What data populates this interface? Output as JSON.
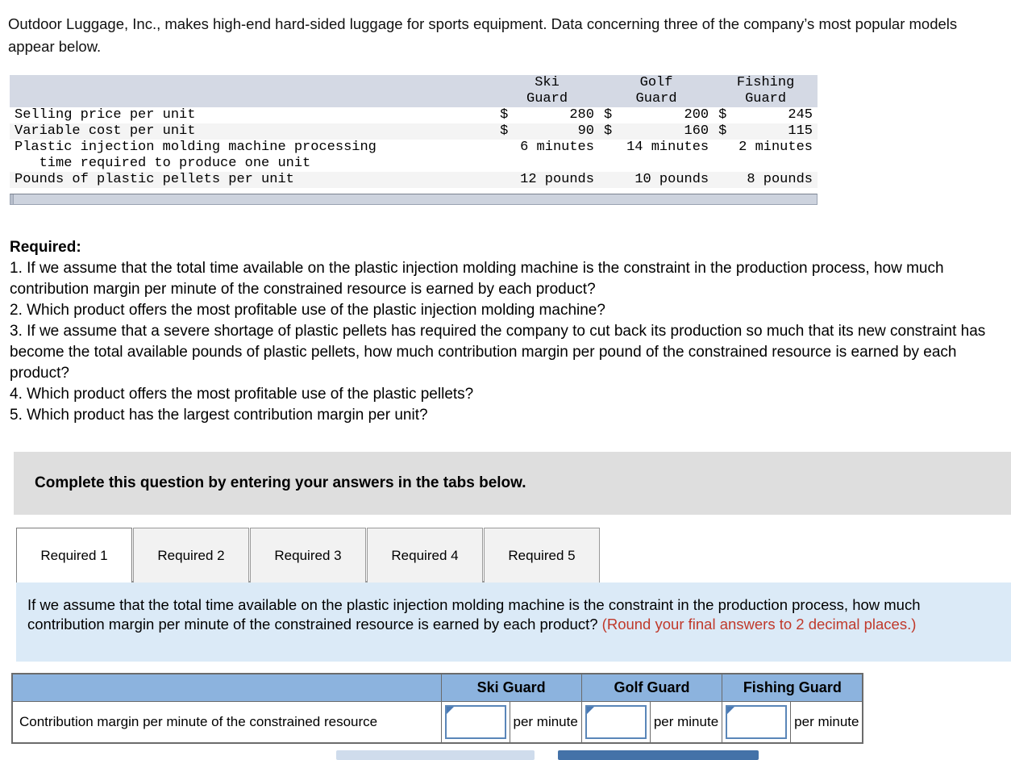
{
  "intro": "Outdoor Luggage, Inc., makes high-end hard-sided luggage for sports equipment. Data concerning three of the company’s most popular models appear below.",
  "facts_table": {
    "columns": [
      "",
      "Ski Guard",
      "Golf Guard",
      "Fishing Guard"
    ],
    "column_lines": [
      [
        "Ski",
        "Guard"
      ],
      [
        "Golf",
        "Guard"
      ],
      [
        "Fishing",
        "Guard"
      ]
    ],
    "rows": [
      {
        "label": "Selling price per unit",
        "label_line2": "",
        "currency": [
          "$",
          "$",
          "$"
        ],
        "values": [
          "280",
          "200",
          "245"
        ],
        "units": [
          "",
          "",
          ""
        ]
      },
      {
        "label": "Variable cost per unit",
        "label_line2": "",
        "currency": [
          "$",
          "$",
          "$"
        ],
        "values": [
          "90",
          "160",
          "115"
        ],
        "units": [
          "",
          "",
          ""
        ]
      },
      {
        "label": "Plastic injection molding machine processing",
        "label_line2": "   time required to produce one unit",
        "currency": [
          "",
          "",
          ""
        ],
        "values": [
          "6",
          "14",
          "2"
        ],
        "units": [
          "6 minutes",
          "14 minutes",
          "2 minutes"
        ]
      },
      {
        "label": "Pounds of plastic pellets per unit",
        "label_line2": "",
        "currency": [
          "",
          "",
          ""
        ],
        "values": [
          "12",
          "10",
          "8"
        ],
        "units": [
          "12 pounds",
          "10 pounds",
          "8 pounds"
        ]
      }
    ]
  },
  "required": {
    "heading": "Required:",
    "items": [
      "1. If we assume that the total time available on the plastic injection molding machine is the constraint in the production process, how much contribution margin per minute of the constrained resource is earned by each product?",
      "2. Which product offers the most profitable use of the plastic injection molding machine?",
      "3. If we assume that a severe shortage of plastic pellets has required the company to cut back its production so much that its new constraint has become the total available pounds of plastic pellets, how much contribution margin per pound of the constrained resource is earned by each product?",
      "4. Which product offers the most profitable use of the plastic pellets?",
      "5. Which product has the largest contribution margin per unit?"
    ]
  },
  "banner": {
    "text": "Complete this question by entering your answers in the tabs below."
  },
  "tabs": {
    "items": [
      {
        "label": "Required 1",
        "active": true
      },
      {
        "label": "Required 2",
        "active": false
      },
      {
        "label": "Required 3",
        "active": false
      },
      {
        "label": "Required 4",
        "active": false
      },
      {
        "label": "Required 5",
        "active": false
      }
    ]
  },
  "question_panel": {
    "text": "If we assume that the total time available on the plastic injection molding machine is the constraint in the production process, how much contribution margin per minute of the constrained resource is earned by each product? ",
    "note": "(Round your final answers to 2 decimal places.)"
  },
  "answer_table": {
    "headers": [
      "",
      "Ski Guard",
      "Golf Guard",
      "Fishing Guard"
    ],
    "row_label": "Contribution margin per minute of the constrained resource",
    "inputs": [
      {
        "value": "",
        "unit": "per minute"
      },
      {
        "value": "",
        "unit": "per minute"
      },
      {
        "value": "",
        "unit": "per minute"
      }
    ]
  },
  "buttons": {
    "prev_label": "",
    "next_label": ""
  },
  "colors": {
    "facts_header_bg": "#d4d9e4",
    "banner_bg": "#dedede",
    "question_panel_bg": "#dbeaf7",
    "note_red": "#c0392b",
    "answer_header_bg": "#8cb3de",
    "input_border": "#5a86b8",
    "next_button": "#4472a8",
    "prev_button": "#cfdcec"
  }
}
